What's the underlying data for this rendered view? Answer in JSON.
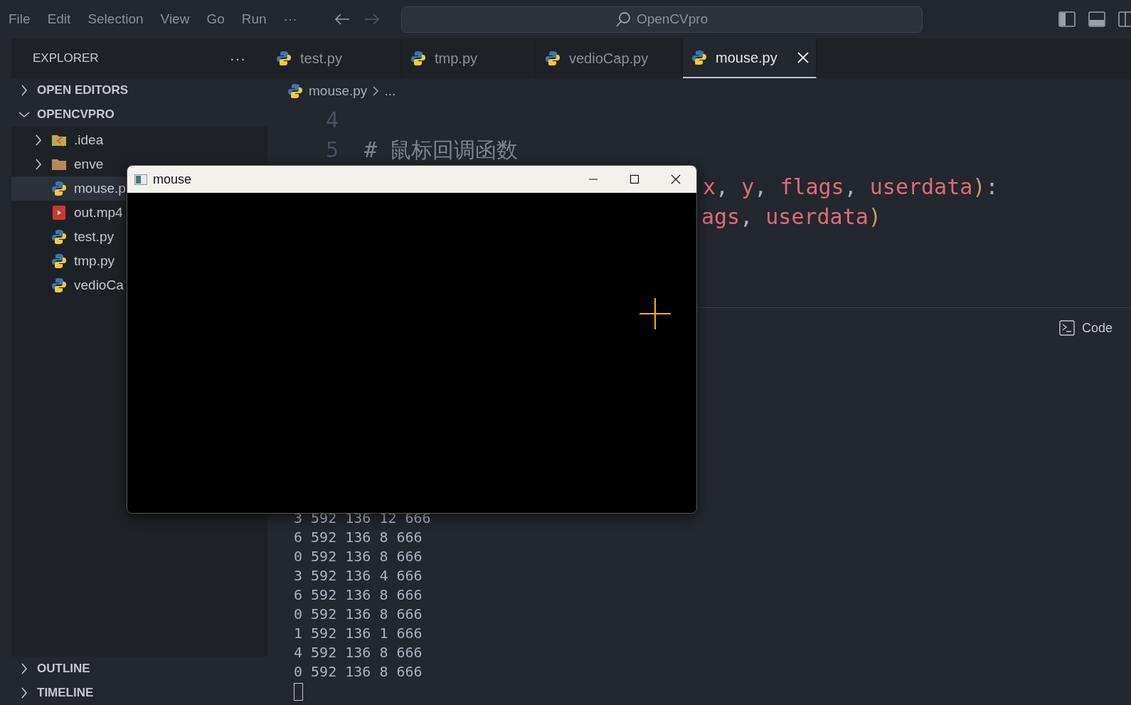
{
  "menu": [
    "File",
    "Edit",
    "Selection",
    "View",
    "Go",
    "Run",
    "···"
  ],
  "command_center": {
    "title": "OpenCVpro"
  },
  "sidebar": {
    "title": "EXPLORER",
    "more": "···",
    "sections": [
      {
        "label": "OPEN EDITORS",
        "expanded": false
      },
      {
        "label": "OPENCVPRO",
        "expanded": true
      }
    ],
    "tree": [
      {
        "name": ".idea",
        "kind": "idea-folder",
        "selected": false
      },
      {
        "name": "enve",
        "kind": "folder",
        "selected": false
      },
      {
        "name": "mouse.p",
        "kind": "python",
        "selected": true
      },
      {
        "name": "out.mp4",
        "kind": "video",
        "selected": false
      },
      {
        "name": "test.py",
        "kind": "python",
        "selected": false
      },
      {
        "name": "tmp.py",
        "kind": "python",
        "selected": false
      },
      {
        "name": "vedioCa",
        "kind": "python",
        "selected": false
      }
    ],
    "bottom_sections": [
      {
        "label": "OUTLINE",
        "expanded": false
      },
      {
        "label": "TIMELINE",
        "expanded": false
      }
    ]
  },
  "tabs": [
    {
      "label": "test.py",
      "selected": false
    },
    {
      "label": "tmp.py",
      "selected": false
    },
    {
      "label": "vedioCap.py",
      "selected": false
    },
    {
      "label": "mouse.py",
      "selected": true
    }
  ],
  "breadcrumb": {
    "file": "mouse.py",
    "rest": "..."
  },
  "editor": {
    "lines": [
      {
        "number": "4"
      },
      {
        "number": "5",
        "tokens": [
          {
            "text": "# 鼠标回调函数",
            "kind": "comment"
          }
        ]
      },
      {
        "tokens": [
          {
            "text": "x",
            "kind": "param"
          },
          {
            "text": ", ",
            "kind": "punct"
          },
          {
            "text": "y",
            "kind": "param"
          },
          {
            "text": ", ",
            "kind": "punct"
          },
          {
            "text": "flags",
            "kind": "param"
          },
          {
            "text": ", ",
            "kind": "punct"
          },
          {
            "text": "userdata",
            "kind": "param"
          },
          {
            "text": ")",
            "kind": "paren"
          },
          {
            "text": ":",
            "kind": "punct"
          }
        ]
      },
      {
        "tokens": [
          {
            "text": "ags",
            "kind": "param"
          },
          {
            "text": ", ",
            "kind": "punct"
          },
          {
            "text": "userdata",
            "kind": "param"
          },
          {
            "text": ")",
            "kind": "paren"
          }
        ]
      }
    ]
  },
  "panel": {
    "terminal_label": "Code",
    "output": [
      "3 592 136 12 666",
      "6 592 136 8 666",
      "0 592 136 8 666",
      "3 592 136 4 666",
      "6 592 136 8 666",
      "0 592 136 8 666",
      "1 592 136 1 666",
      "4 592 136 8 666",
      "0 592 136 8 666"
    ]
  },
  "window": {
    "title": "mouse"
  }
}
